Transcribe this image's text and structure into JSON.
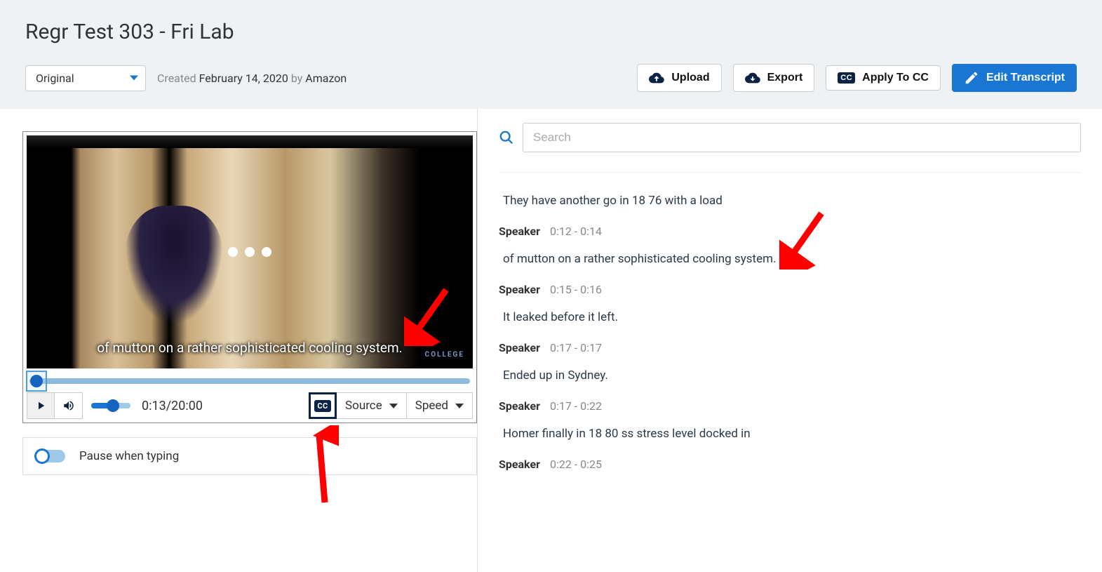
{
  "page": {
    "title": "Regr Test 303 - Fri Lab"
  },
  "version": {
    "selected": "Original",
    "created_prefix": "Created ",
    "created_date": "February 14, 2020",
    "created_by_prefix": " by ",
    "created_by": "Amazon"
  },
  "actions": {
    "upload": "Upload",
    "export": "Export",
    "apply_cc": "Apply To CC",
    "edit": "Edit Transcript",
    "cc_badge": "CC"
  },
  "player": {
    "caption_text": "of mutton on a rather sophisticated cooling system.",
    "watermark": "COLLEGE",
    "time": "0:13/20:00",
    "source_label": "Source",
    "speed_label": "Speed",
    "cc_badge": "CC"
  },
  "options": {
    "pause_label": "Pause when typing"
  },
  "search": {
    "placeholder": "Search"
  },
  "transcript": {
    "speaker_label": "Speaker",
    "entries": [
      {
        "text": "They have another go in 18 76 with a load",
        "ts": ""
      },
      {
        "text": "of mutton on a rather sophisticated cooling system.",
        "ts": "0:12 - 0:14"
      },
      {
        "text": "It leaked before it left.",
        "ts": "0:15 - 0:16"
      },
      {
        "text": "Ended up in Sydney.",
        "ts": "0:17 - 0:17"
      },
      {
        "text": "Homer finally in 18 80 ss stress level docked in",
        "ts": "0:17 - 0:22"
      },
      {
        "text": "",
        "ts": "0:22 - 0:25"
      }
    ]
  }
}
